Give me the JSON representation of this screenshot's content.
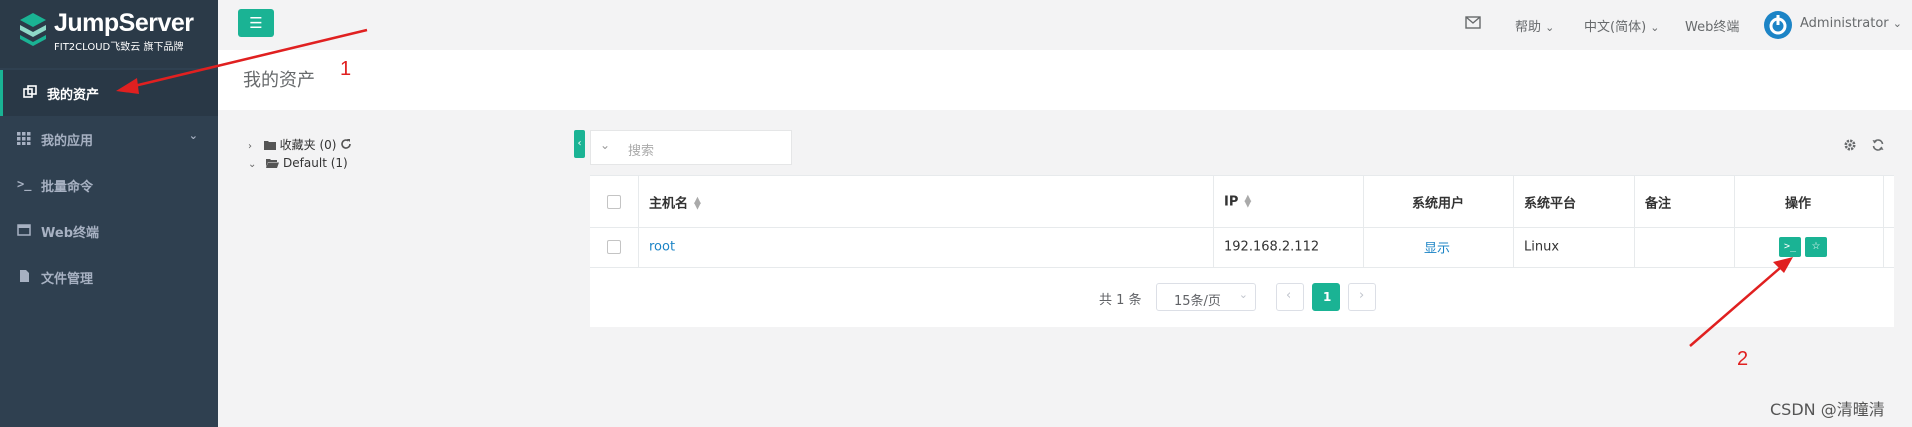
{
  "app": {
    "brand_title": "JumpServer",
    "brand_subtitle": "FIT2CLOUD飞致云 旗下品牌"
  },
  "sidebar": {
    "items": [
      {
        "label": "我的资产",
        "icon": "assets-icon",
        "active": true
      },
      {
        "label": "我的应用",
        "icon": "grid-icon",
        "expandable": true
      },
      {
        "label": "批量命令",
        "icon": "terminal-icon"
      },
      {
        "label": "Web终端",
        "icon": "window-icon"
      },
      {
        "label": "文件管理",
        "icon": "file-icon"
      }
    ]
  },
  "topbar": {
    "help": "帮助",
    "language": "中文(简体)",
    "web_terminal": "Web终端",
    "user": "Administrator"
  },
  "page": {
    "title": "我的资产"
  },
  "tree": {
    "favorites": "收藏夹 (0)",
    "default": "Default (1)"
  },
  "search": {
    "placeholder": "搜索"
  },
  "table": {
    "headers": [
      "主机名",
      "IP",
      "系统用户",
      "系统平台",
      "备注",
      "操作"
    ],
    "rows": [
      {
        "hostname": "root",
        "ip": "192.168.2.112",
        "system_user": "显示",
        "platform": "Linux",
        "note": ""
      }
    ]
  },
  "pagination": {
    "total": "共 1 条",
    "page_size": "15条/页",
    "current_page": "1"
  },
  "annotations": {
    "marker_1": "1",
    "marker_2": "2",
    "arrow_color": "#e02020"
  },
  "watermark": "CSDN @清曈清",
  "colors": {
    "accent": "#1ab394",
    "sidebar_bg": "#2f4050",
    "link": "#1c84c6"
  }
}
